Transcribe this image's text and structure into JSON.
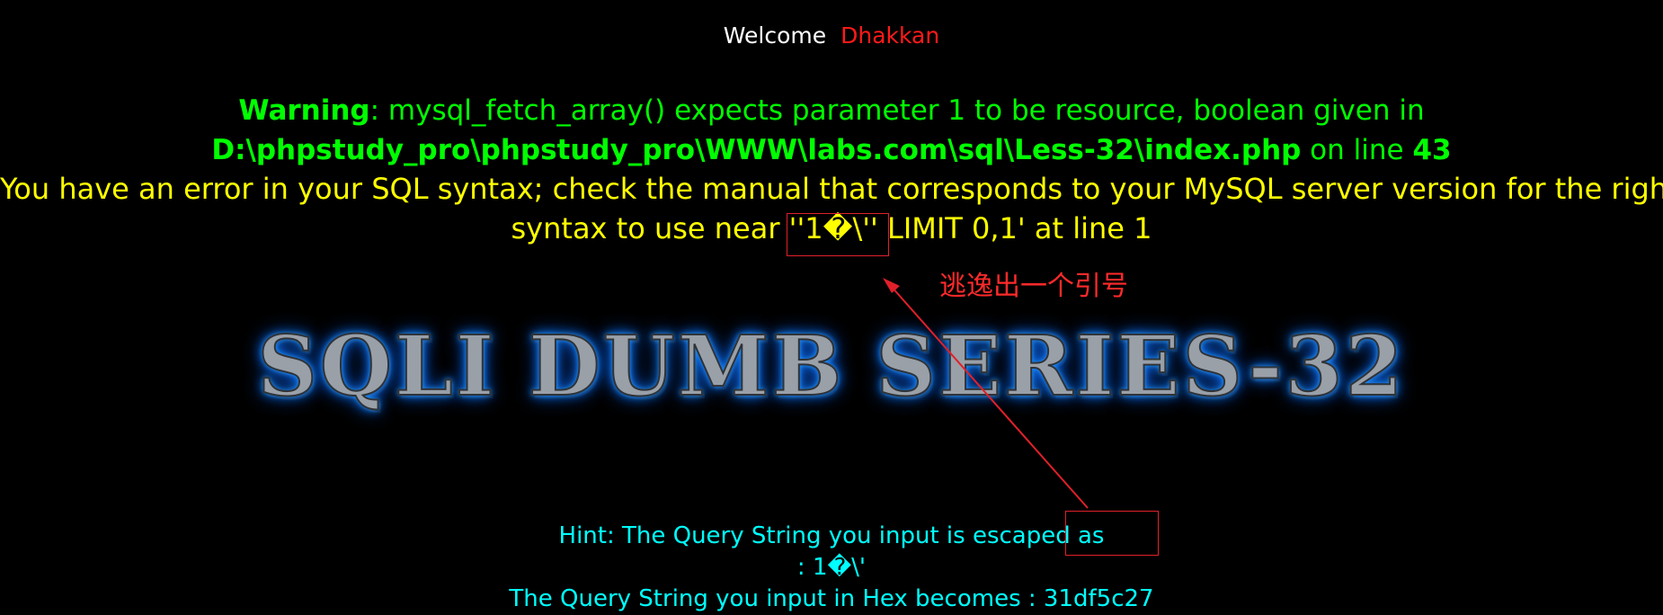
{
  "welcome": {
    "label": "Welcome",
    "name": "Dhakkan"
  },
  "warning": {
    "label": "Warning",
    "message": ": mysql_fetch_array() expects parameter 1 to be resource, boolean given in",
    "path": "D:\\phpstudy_pro\\phpstudy_pro\\WWW\\labs.com\\sql\\Less-32\\index.php",
    "on_line_text": " on line ",
    "line_number": "43"
  },
  "sql_error": {
    "line1": "You have an error in your SQL syntax; check the manual that corresponds to your MySQL server version for the right",
    "line2_prefix": "syntax to use near ",
    "line2_highlight": "''1�\\''",
    "line2_suffix": " LIMIT 0,1' at line 1"
  },
  "annotation": {
    "text": "逃逸出一个引号",
    "color": "#ff2a2a"
  },
  "banner": {
    "title": "SQLI DUMB SERIES-32"
  },
  "hint": {
    "line1_prefix": "Hint: The Query String you input is escaped as",
    "line1_value": " : 1�\\'",
    "line2": "The Query String you input in Hex becomes : 31df5c27"
  },
  "colors": {
    "background": "#000000",
    "warning_green": "#00ff00",
    "error_yellow": "#ffff00",
    "hint_cyan": "#00ffff",
    "name_red": "#ff1a1a"
  }
}
